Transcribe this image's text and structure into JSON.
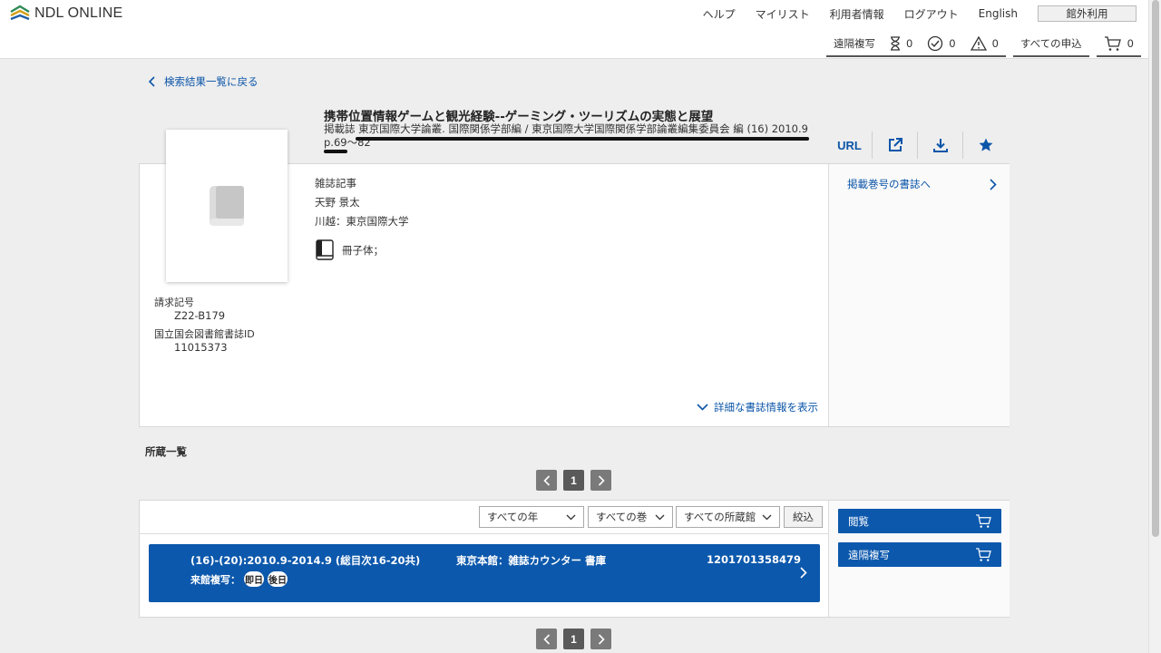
{
  "header": {
    "logo_text": "NDL ONLINE",
    "nav": [
      "ヘルプ",
      "マイリスト",
      "利用者情報",
      "ログアウト",
      "English"
    ],
    "outside_use": "館外利用",
    "remote_copy": "遠隔複写",
    "pending_count": "0",
    "done_count": "0",
    "warn_count": "0",
    "all_requests": "すべての申込",
    "cart_count": "0"
  },
  "back_link": "検索結果一覧に戻る",
  "item": {
    "title": "携帯位置情報ゲームと観光経験--ゲーミング・ツーリズムの実態と展望",
    "source": "掲載誌 東京国際大学論叢. 国際関係学部編 / 東京国際大学国際関係学部論叢編集委員会 編 (16) 2010.9 p.69～82",
    "url_label": "URL",
    "type": "雑誌記事",
    "author": "天野 景太",
    "publisher": "川越：東京国際大学",
    "format": "冊子体；",
    "call_number_label": "請求記号",
    "call_number": "Z22-B179",
    "ndl_id_label": "国立国会図書館書誌ID",
    "ndl_id": "11015373",
    "detail_link": "詳細な書誌情報を表示",
    "related_link": "掲載巻号の書誌へ"
  },
  "holdings": {
    "title": "所蔵一覧",
    "page": "1",
    "filters": {
      "year": "すべての年",
      "volume": "すべての巻",
      "library": "すべての所蔵館",
      "narrow": "絞込"
    },
    "rows": [
      {
        "volume": "(16)-(20):2010.9-2014.9 (総目次16-20共)",
        "location": "東京本館：雑誌カウンター 書庫",
        "number": "1201701358479",
        "copy_label": "来館複写：",
        "badge1": "即日",
        "badge2": "後日"
      }
    ],
    "view_btn": "閲覧",
    "remote_copy_btn": "遠隔複写"
  }
}
